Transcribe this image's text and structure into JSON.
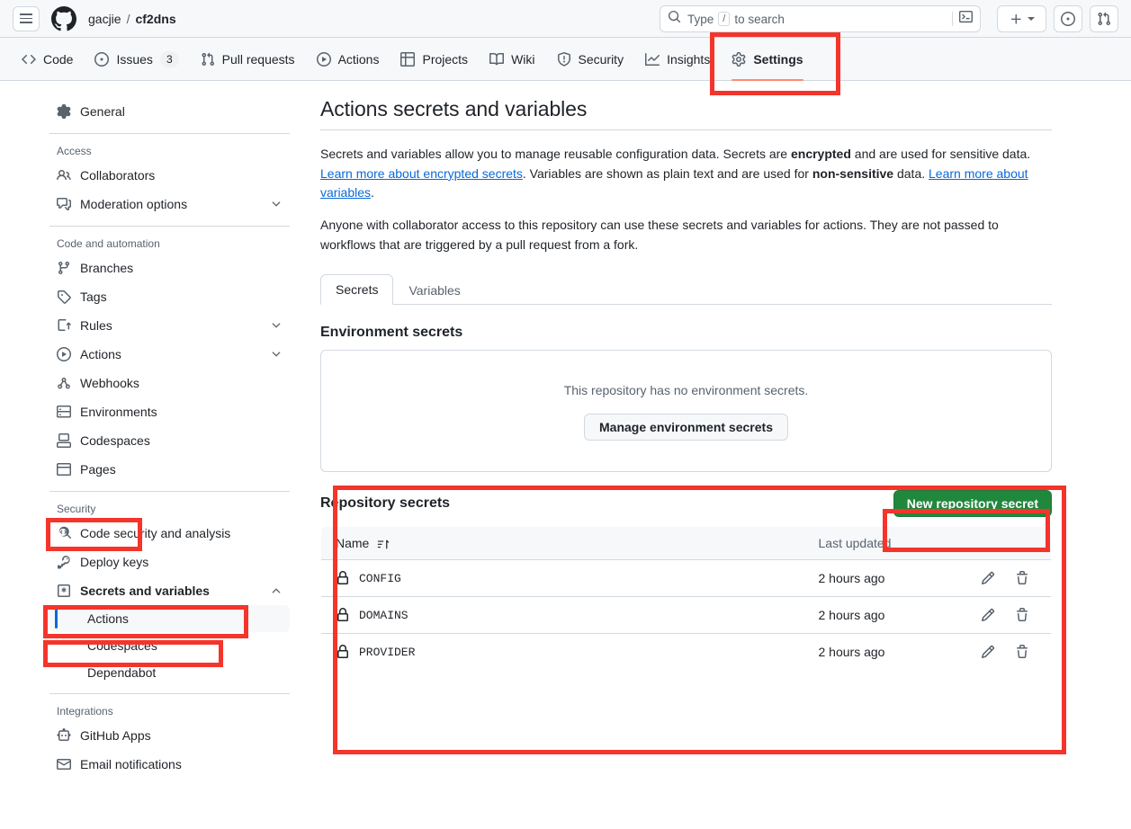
{
  "header": {
    "menu_label": "Open navigation menu",
    "owner": "gacjie",
    "separator": "/",
    "repo": "cf2dns",
    "search_placeholder": "Type",
    "search_key": "/",
    "search_suffix": "to search",
    "buttons": [
      {
        "name": "create-new-button",
        "label": "+"
      },
      {
        "name": "issues-button",
        "label": ""
      },
      {
        "name": "pull-requests-button",
        "label": ""
      }
    ]
  },
  "repo_nav": [
    {
      "label": "Code",
      "icon": "code-icon",
      "active": false
    },
    {
      "label": "Issues",
      "icon": "issue-opened-icon",
      "badge": "3",
      "active": false
    },
    {
      "label": "Pull requests",
      "icon": "git-pull-request-icon",
      "active": false
    },
    {
      "label": "Actions",
      "icon": "play-icon",
      "active": false
    },
    {
      "label": "Projects",
      "icon": "table-icon",
      "active": false
    },
    {
      "label": "Wiki",
      "icon": "book-icon",
      "active": false
    },
    {
      "label": "Security",
      "icon": "shield-icon",
      "active": false
    },
    {
      "label": "Insights",
      "icon": "graph-icon",
      "active": false
    },
    {
      "label": "Settings",
      "icon": "gear-icon",
      "active": true
    }
  ],
  "sidebar": {
    "general": {
      "label": "General",
      "icon": "gear-icon"
    },
    "sections": [
      {
        "title": "Access",
        "items": [
          {
            "label": "Collaborators",
            "icon": "people-icon",
            "chevron": null
          },
          {
            "label": "Moderation options",
            "icon": "comment-discussion-icon",
            "chevron": "down"
          }
        ]
      },
      {
        "title": "Code and automation",
        "items": [
          {
            "label": "Branches",
            "icon": "git-branch-icon",
            "chevron": null
          },
          {
            "label": "Tags",
            "icon": "tag-icon",
            "chevron": null
          },
          {
            "label": "Rules",
            "icon": "rules-icon",
            "chevron": "down"
          },
          {
            "label": "Actions",
            "icon": "play-icon",
            "chevron": "down"
          },
          {
            "label": "Webhooks",
            "icon": "webhook-icon",
            "chevron": null
          },
          {
            "label": "Environments",
            "icon": "server-icon",
            "chevron": null
          },
          {
            "label": "Codespaces",
            "icon": "codespaces-icon",
            "chevron": null
          },
          {
            "label": "Pages",
            "icon": "browser-icon",
            "chevron": null
          }
        ]
      },
      {
        "title": "Security",
        "items": [
          {
            "label": "Code security and analysis",
            "icon": "codescan-icon",
            "chevron": null
          },
          {
            "label": "Deploy keys",
            "icon": "key-icon",
            "chevron": null
          },
          {
            "label": "Secrets and variables",
            "icon": "secret-icon",
            "chevron": "up",
            "bold": true
          }
        ],
        "subitems": [
          {
            "label": "Actions",
            "selected": true
          },
          {
            "label": "Codespaces",
            "selected": false
          },
          {
            "label": "Dependabot",
            "selected": false
          }
        ]
      },
      {
        "title": "Integrations",
        "items": [
          {
            "label": "GitHub Apps",
            "icon": "apps-icon",
            "chevron": null
          },
          {
            "label": "Email notifications",
            "icon": "mail-icon",
            "chevron": null
          }
        ]
      }
    ]
  },
  "main": {
    "title": "Actions secrets and variables",
    "desc1_a": "Secrets and variables allow you to manage reusable configuration data. Secrets are ",
    "desc1_bold1": "encrypted",
    "desc1_b": " and are used for sensitive data. ",
    "desc1_link1": "Learn more about encrypted secrets",
    "desc1_c": ". Variables are shown as plain text and are used for ",
    "desc1_bold2": "non-sensitive",
    "desc1_d": " data. ",
    "desc1_link2": "Learn more about variables",
    "desc1_e": ".",
    "desc2": "Anyone with collaborator access to this repository can use these secrets and variables for actions. They are not passed to workflows that are triggered by a pull request from a fork.",
    "tabs": [
      {
        "label": "Secrets",
        "active": true
      },
      {
        "label": "Variables",
        "active": false
      }
    ],
    "environment": {
      "heading": "Environment secrets",
      "empty_text": "This repository has no environment secrets.",
      "manage_button": "Manage environment secrets"
    },
    "repository_secrets": {
      "heading": "Repository secrets",
      "new_button": "New repository secret",
      "columns": {
        "name": "Name",
        "last_updated": "Last updated"
      },
      "rows": [
        {
          "name": "CONFIG",
          "last_updated": "2 hours ago"
        },
        {
          "name": "DOMAINS",
          "last_updated": "2 hours ago"
        },
        {
          "name": "PROVIDER",
          "last_updated": "2 hours ago"
        }
      ]
    }
  },
  "colors": {
    "annotation": "#f5342b",
    "green_button": "#1f883d",
    "active_tab_underline": "#fd8c73",
    "selected_sidebar": "#0969da",
    "link": "#0969da"
  }
}
